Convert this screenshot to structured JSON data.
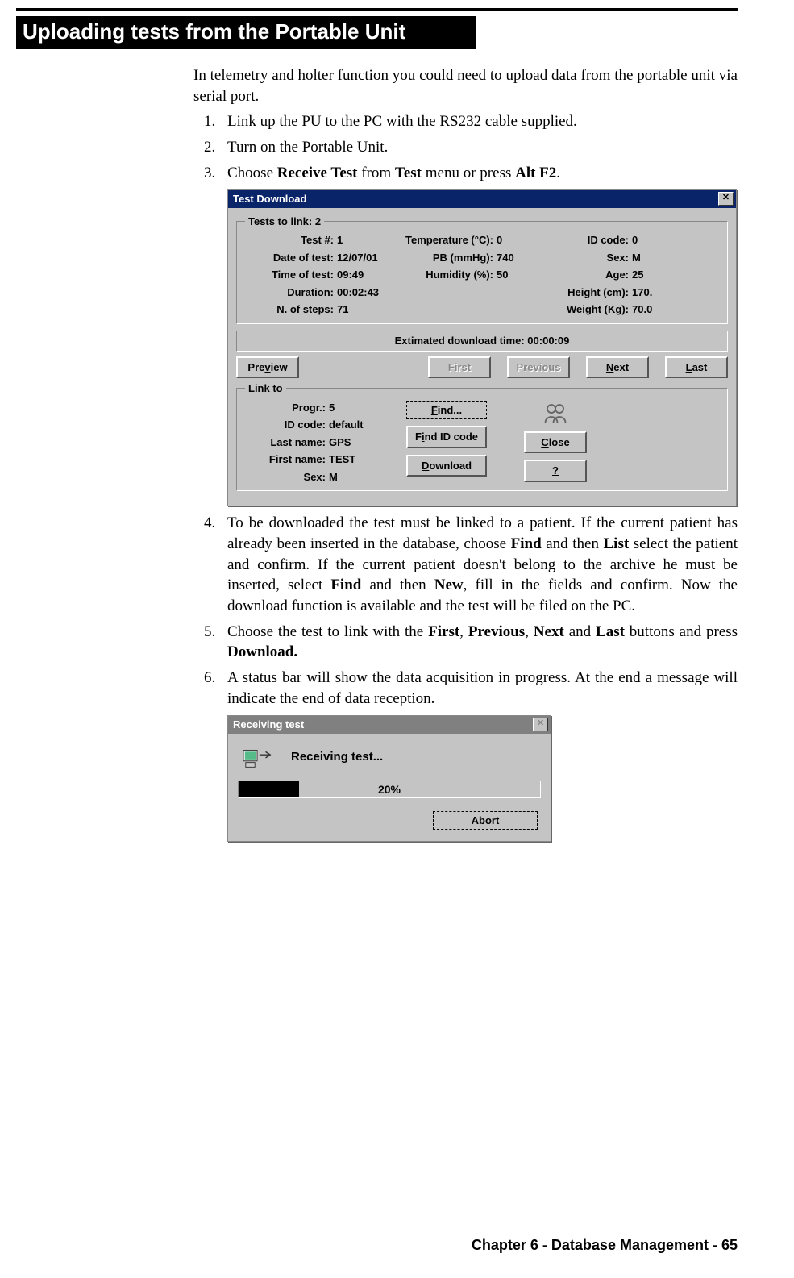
{
  "section_title": "Uploading tests from the Portable Unit",
  "intro": "In telemetry and holter function you could need to upload data from the portable unit via serial port.",
  "steps": {
    "s1": "Link up the PU to the PC with the RS232 cable supplied.",
    "s2": "Turn on the Portable Unit.",
    "s3_prefix": "Choose ",
    "s3_b1": "Receive Test",
    "s3_mid1": " from ",
    "s3_b2": "Test",
    "s3_mid2": " menu or press ",
    "s3_b3": "Alt F2",
    "s3_suffix": ".",
    "s4_p1": "To be downloaded the test must be linked to a patient. If the current patient has already been inserted in the database, choose ",
    "s4_b1": "Find",
    "s4_p2": " and then ",
    "s4_b2": "List",
    "s4_p3": " select the patient and confirm. If the current patient doesn't belong to the archive he must be inserted, select ",
    "s4_b3": "Find",
    "s4_p4": " and then ",
    "s4_b4": "New",
    "s4_p5": ", fill in the fields and confirm. Now the download function is available and the test will be filed on the PC.",
    "s5_p1": "Choose the test to link with the ",
    "s5_b1": "First",
    "s5_c": ", ",
    "s5_b2": "Previous",
    "s5_c2": ", ",
    "s5_b3": "Next",
    "s5_p2": " and ",
    "s5_b4": "Last",
    "s5_p3": " buttons and press ",
    "s5_b5": "Download.",
    "s6": "A status bar will show the data acquisition in progress. At the end a message will indicate the end of data reception."
  },
  "dialog1": {
    "title": "Test Download",
    "tests_to_link_legend": "Tests to link: 2",
    "labels": {
      "test_no": "Test #:",
      "date": "Date of test:",
      "time": "Time of test:",
      "duration": "Duration:",
      "steps": "N. of steps:",
      "temp": "Temperature (°C):",
      "pb": "PB (mmHg):",
      "humidity": "Humidity (%):",
      "idcode": "ID code:",
      "sex": "Sex:",
      "age": "Age:",
      "height": "Height (cm):",
      "weight": "Weight (Kg):"
    },
    "values": {
      "test_no": "1",
      "date": "12/07/01",
      "time": "09:49",
      "duration": "00:02:43",
      "steps": "71",
      "temp": "0",
      "pb": "740",
      "humidity": "50",
      "idcode": "0",
      "sex": "M",
      "age": "25",
      "height": "170.",
      "weight": "70.0"
    },
    "est_time": "Extimated download time: 00:00:09",
    "buttons": {
      "preview_pre": "Pre",
      "preview_u": "v",
      "preview_post": "iew",
      "first": "First",
      "previous": "Previous",
      "next_u": "N",
      "next_post": "ext",
      "last_u": "L",
      "last_post": "ast"
    },
    "linkto": {
      "legend": "Link to",
      "labels": {
        "progr": "Progr.:",
        "idcode": "ID code:",
        "last": "Last name:",
        "first": "First name:",
        "sex": "Sex:"
      },
      "values": {
        "progr": "5",
        "idcode": "default",
        "last": "GPS",
        "first": "TEST",
        "sex": "M"
      },
      "buttons": {
        "find_u": "F",
        "find_post": "ind...",
        "findid_pre": "F",
        "findid_u": "i",
        "findid_post": "nd ID code",
        "download_u": "D",
        "download_post": "ownload",
        "close_u": "C",
        "close_post": "lose",
        "help": "?"
      }
    }
  },
  "dialog2": {
    "title": "Receiving test",
    "message": "Receiving test...",
    "percent": "20%",
    "abort": "Abort"
  },
  "footer": "Chapter 6 - Database Management - 65"
}
